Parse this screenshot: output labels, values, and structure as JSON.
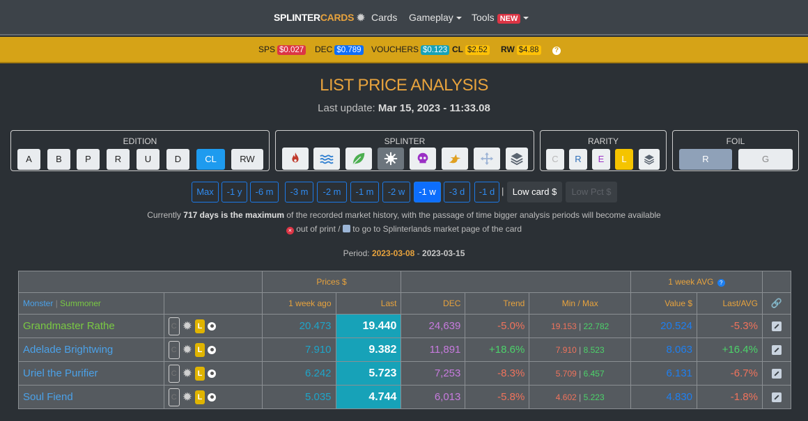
{
  "nav": {
    "brand_white": "SPLINTER",
    "brand_yellow": "CARDS",
    "links": [
      "Cards",
      "Gameplay",
      "Tools"
    ],
    "new_badge": "NEW"
  },
  "prices": {
    "sps_label": "SPS",
    "sps_value": "$0.027",
    "dec_label": "DEC",
    "dec_value": "$0.789",
    "vouchers_label": "VOUCHERS",
    "vouchers_value": "$0.123",
    "cl_label": "CL",
    "cl_value": "$2.52",
    "rw_label": "RW",
    "rw_value": "$4.88"
  },
  "page": {
    "title": "LIST PRICE ANALYSIS",
    "last_update_label": "Last update:",
    "last_update_value": "Mar 15, 2023 - 11:33.08"
  },
  "filters": {
    "edition_label": "EDITION",
    "editions": [
      "A",
      "B",
      "P",
      "R",
      "U",
      "D",
      "CL",
      "RW"
    ],
    "edition_selected": "CL",
    "splinter_label": "SPLINTER",
    "splinters": [
      "fire-icon",
      "water-icon",
      "earth-icon",
      "neutral-icon",
      "death-icon",
      "dragon-icon",
      "life-icon",
      "all-icon"
    ],
    "rarity_label": "RARITY",
    "rarities": [
      "C",
      "R",
      "E",
      "L"
    ],
    "rarity_selected": "L",
    "foil_label": "FOIL",
    "foils": [
      "R",
      "G"
    ],
    "foil_selected": "R"
  },
  "periods": {
    "items": [
      "Max",
      "-1 y",
      "-6 m",
      "-3 m",
      "-2 m",
      "-1 m",
      "-2 w",
      "-1 w",
      "-3 d",
      "-1 d"
    ],
    "selected": "-1 w",
    "low_card": "Low card $",
    "low_pct": "Low Pct $"
  },
  "info": {
    "pre": "Currently ",
    "bold": "717 days is the maximum",
    "post": " of the recorded market history, with the passage of time bigger analysis periods will become available",
    "legend_a": " out of print / ",
    "legend_b": " to go to Splinterlands market page of the card",
    "period_label": "Period: ",
    "period_start": "2023-03-08",
    "period_sep": " - ",
    "period_end": "2023-03-15"
  },
  "table": {
    "group_prices": "Prices $",
    "group_week": "1 week AVG",
    "col_monster": "Monster",
    "col_summoner": "Summoner",
    "col_week_ago": "1 week ago",
    "col_last": "Last",
    "col_dec": "DEC",
    "col_trend": "Trend",
    "col_minmax": "Min / Max",
    "col_value": "Value $",
    "col_lastavg": "Last/AVG",
    "rows": [
      {
        "name": "Grandmaster Rathe",
        "kind": "summoner",
        "week_ago": "20.473",
        "last": "19.440",
        "dec": "24,639",
        "trend": "-5.0%",
        "min": "19.153",
        "max": "22.782",
        "value": "20.524",
        "lastavg": "-5.3%"
      },
      {
        "name": "Adelade Brightwing",
        "kind": "monster",
        "week_ago": "7.910",
        "last": "9.382",
        "dec": "11,891",
        "trend": "+18.6%",
        "min": "7.910",
        "max": "8.523",
        "value": "8.063",
        "lastavg": "+16.4%"
      },
      {
        "name": "Uriel the Purifier",
        "kind": "monster",
        "week_ago": "6.242",
        "last": "5.723",
        "dec": "7,253",
        "trend": "-8.3%",
        "min": "5.709",
        "max": "6.457",
        "value": "6.131",
        "lastavg": "-6.7%"
      },
      {
        "name": "Soul Fiend",
        "kind": "monster",
        "week_ago": "5.035",
        "last": "4.744",
        "dec": "6,013",
        "trend": "-5.8%",
        "min": "4.602",
        "max": "5.223",
        "value": "4.830",
        "lastavg": "-1.8%"
      }
    ],
    "tag_c": "C",
    "tag_l": "L"
  }
}
